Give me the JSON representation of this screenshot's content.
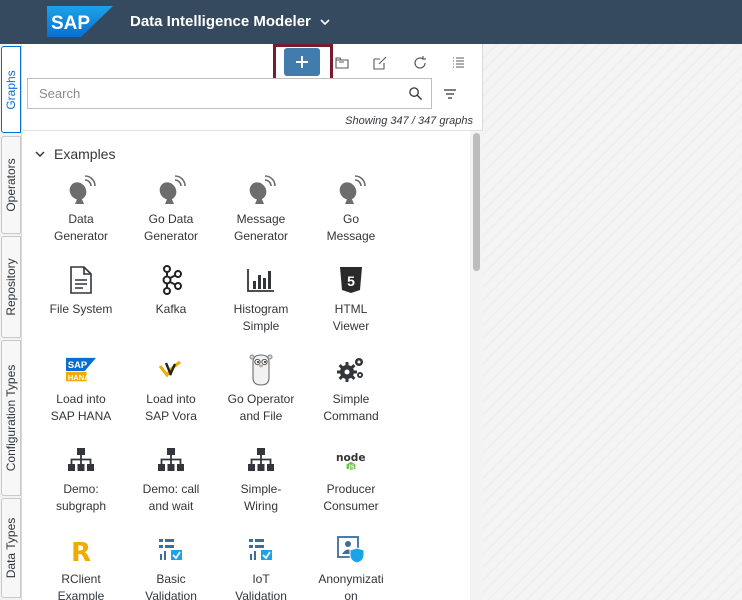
{
  "header": {
    "logo_text": "SAP",
    "app_title": "Data Intelligence Modeler",
    "brand_color": "#354a5f",
    "logo_color": "#0a6ed1"
  },
  "vertical_tabs": [
    {
      "label": "Graphs",
      "active": true
    },
    {
      "label": "Operators",
      "active": false
    },
    {
      "label": "Repository",
      "active": false
    },
    {
      "label": "Configuration Types",
      "active": false
    },
    {
      "label": "Data Types",
      "active": false
    }
  ],
  "toolbar": {
    "buttons": [
      "add-icon",
      "folder-icon",
      "edit-icon",
      "refresh-icon",
      "list-icon"
    ],
    "accent_color": "#427cac",
    "highlight_color": "#7a1c2f"
  },
  "search": {
    "placeholder": "Search",
    "value": ""
  },
  "count_text": "Showing 347 / 347 graphs",
  "group": {
    "label": "Examples",
    "expanded": true
  },
  "graphs": [
    {
      "label": "Data\nGenerator",
      "icon": "satellite-dish-icon"
    },
    {
      "label": "Go Data\nGenerator",
      "icon": "satellite-dish-icon"
    },
    {
      "label": "Message\nGenerator",
      "icon": "satellite-dish-icon"
    },
    {
      "label": "Go\nMessage",
      "icon": "satellite-dish-icon"
    },
    {
      "label": "File System",
      "icon": "document-icon"
    },
    {
      "label": "Kafka",
      "icon": "kafka-icon"
    },
    {
      "label": "Histogram\nSimple",
      "icon": "histogram-icon"
    },
    {
      "label": "HTML\nViewer",
      "icon": "html5-icon"
    },
    {
      "label": "Load into\nSAP HANA",
      "icon": "sap-hana-logo-icon"
    },
    {
      "label": "Load into\nSAP Vora",
      "icon": "sap-vora-logo-icon"
    },
    {
      "label": "Go Operator\nand File",
      "icon": "gopher-icon"
    },
    {
      "label": "Simple\nCommand",
      "icon": "gears-icon"
    },
    {
      "label": "Demo:\nsubgraph",
      "icon": "hierarchy-icon"
    },
    {
      "label": "Demo: call\nand wait",
      "icon": "hierarchy-icon"
    },
    {
      "label": "Simple-\nWiring",
      "icon": "hierarchy-icon"
    },
    {
      "label": "Producer\nConsumer",
      "icon": "nodejs-logo-icon"
    },
    {
      "label": "RClient\nExample",
      "icon": "r-logo-icon"
    },
    {
      "label": "Basic\nValidation",
      "icon": "validation-icon"
    },
    {
      "label": "IoT\nValidation",
      "icon": "validation-icon"
    },
    {
      "label": "Anonymizati\non",
      "icon": "anonymization-icon"
    }
  ]
}
